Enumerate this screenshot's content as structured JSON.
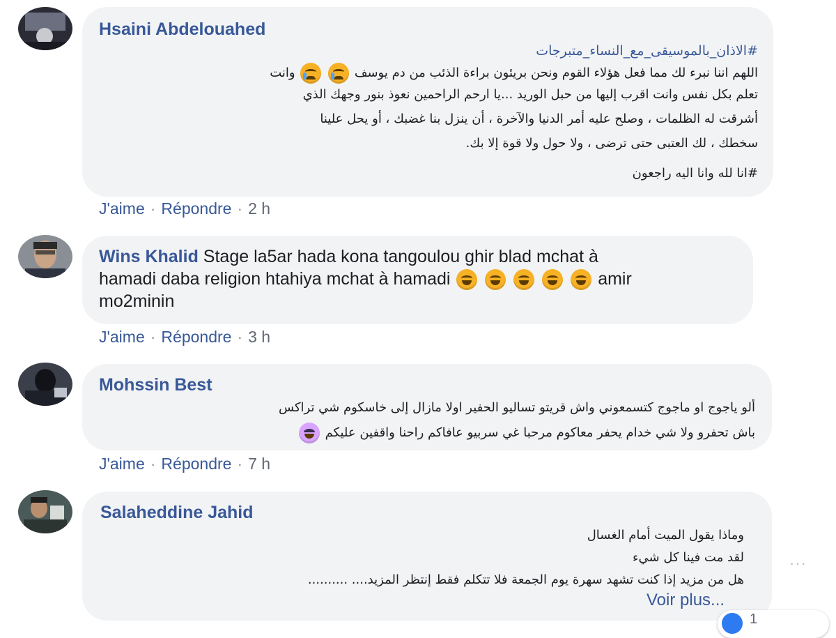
{
  "comments": [
    {
      "author": "Hsaini Abdelouahed",
      "hashtag_top": "#الاذان_بالموسيقى_مع_النساء_متبرجات",
      "lines": [
        "اللهم اننا نبرء لك مما فعل هؤلاء القوم ونحن بريئون براءة الذئب من دم يوسف",
        "تعلم بكل نفس وانت اقرب إليها من حبل الوريد ...يا ارحم الراحمين نعوذ بنور وجهك الذي",
        "أشرقت له الظلمات ، وصلح عليه أمر الدنيا والآخرة ، أن ينزل بنا غضبك ، أو يحل علينا",
        "سخطك ، لك العتبى حتى ترضى ، ولا حول ولا قوة إلا بك."
      ],
      "line1_suffix": "وانت",
      "hashtag_bottom": "#انا لله وانا اليه راجعون",
      "like": "J'aime",
      "reply": "Répondre",
      "time": "2 h"
    },
    {
      "author": "Wins Khalid",
      "text_line1": "Stage la5ar hada kona tangoulou ghir blad mchat à",
      "text_line2": "hamadi daba religion htahiya mchat à hamadi",
      "text_line2_after": "amir",
      "text_line3": "mo2minin",
      "like": "J'aime",
      "reply": "Répondre",
      "time": "3 h"
    },
    {
      "author": "Mohssin Best",
      "lines": [
        "ألو ياجوج او ماجوج كتسمعوني واش قريتو تساليو الحفير اولا مازال إلى خاسكوم شي تراكس",
        "باش تحفرو ولا شي خدام يحفر معاكوم مرحبا غي سربيو عافاكم راحنا واقفين عليكم"
      ],
      "like": "J'aime",
      "reply": "Répondre",
      "time": "7 h"
    },
    {
      "author": "Salaheddine Jahid",
      "lines": [
        "وماذا يقول الميت أمام الغسال",
        "لقد مت فينا كل شيء",
        "هل من مزيد إذا كنت تشهد سهرة يوم الجمعة فلا تتكلم فقط إنتظر المزيد.... .........."
      ],
      "see_more": "Voir plus..."
    }
  ],
  "more_options": "···",
  "reaction_count": "1",
  "icons": {
    "crying": "crying-face-icon",
    "laughing": "rolling-laughing-icon",
    "cool": "cool-face-icon",
    "like": "like-reaction-icon"
  },
  "colors": {
    "author": "#385898",
    "bubble": "#f2f3f5",
    "meta": "#616770"
  }
}
